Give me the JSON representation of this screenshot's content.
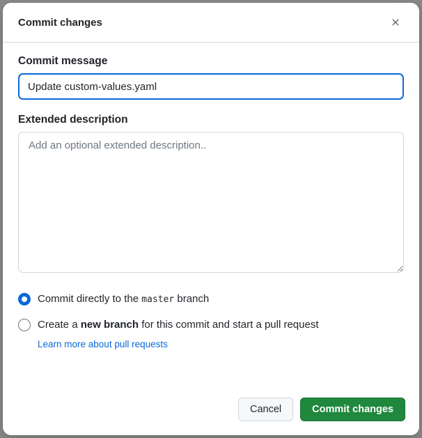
{
  "dialog": {
    "title": "Commit changes"
  },
  "commit": {
    "label": "Commit message",
    "value": "Update custom-values.yaml"
  },
  "extended": {
    "label": "Extended description",
    "placeholder": "Add an optional extended description.."
  },
  "options": {
    "direct_pre": "Commit directly to the ",
    "direct_branch": "master",
    "direct_post": " branch",
    "newbranch_pre": "Create a ",
    "newbranch_bold": "new branch",
    "newbranch_post": " for this commit and start a pull request",
    "learn_link": "Learn more about pull requests",
    "selected": "direct"
  },
  "footer": {
    "cancel": "Cancel",
    "commit": "Commit changes"
  }
}
